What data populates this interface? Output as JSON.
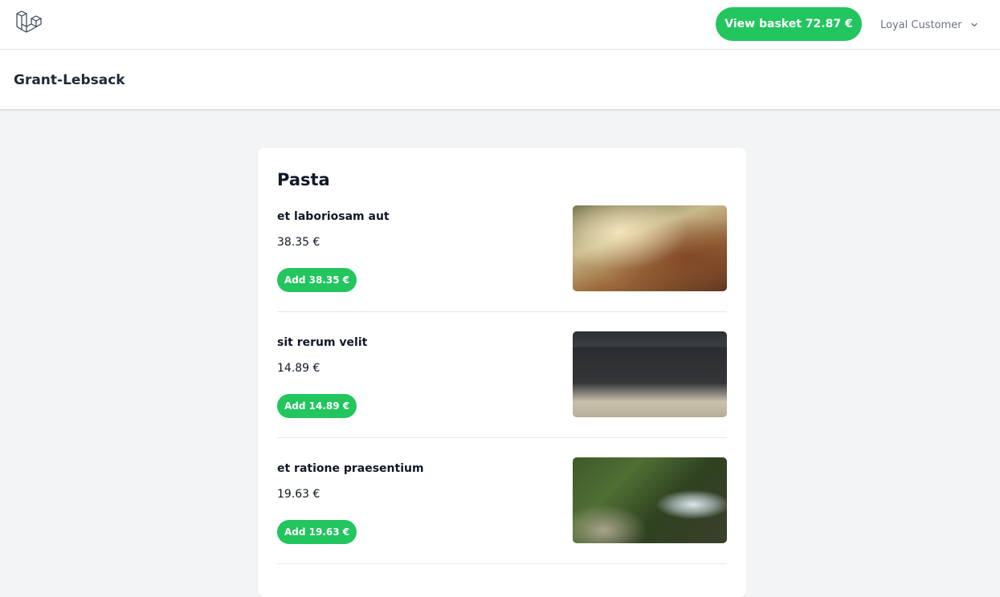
{
  "nav": {
    "logo_icon": "laravel-logo-icon",
    "basket_label": "View basket 72.87 €",
    "user_name": "Loyal Customer",
    "user_menu_icon": "chevron-down-icon",
    "accent_color": "#22c55e"
  },
  "header": {
    "title": "Grant-Lebsack"
  },
  "menu": {
    "category": "Pasta",
    "items": [
      {
        "name": "et laboriosam aut",
        "price": "38.35 €",
        "add_label": "Add 38.35 €",
        "image": "bridge-arch-photo"
      },
      {
        "name": "sit rerum velit",
        "price": "14.89 €",
        "add_label": "Add 14.89 €",
        "image": "interior-room-photo"
      },
      {
        "name": "et ratione praesentium",
        "price": "19.63 €",
        "add_label": "Add 19.63 €",
        "image": "waterfall-photo"
      }
    ]
  }
}
